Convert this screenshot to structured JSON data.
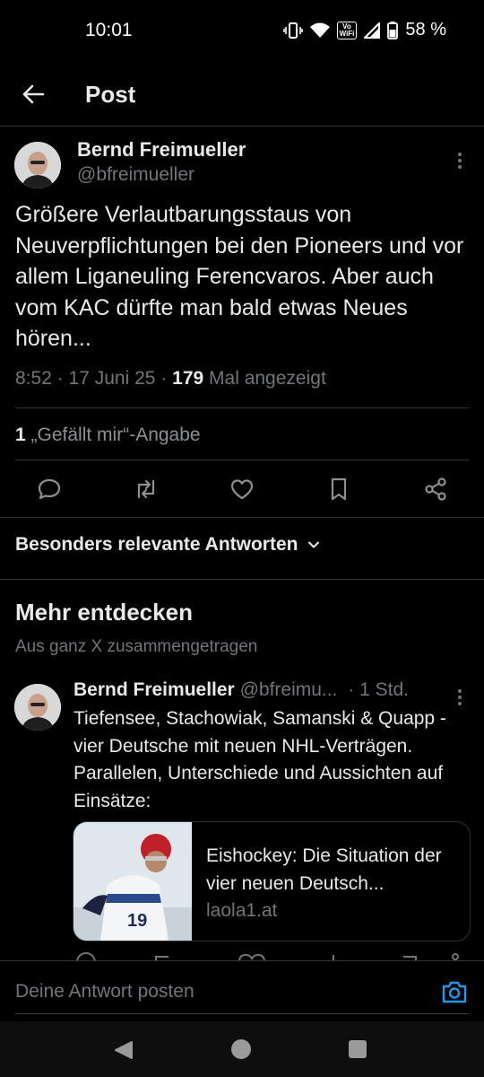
{
  "status_bar": {
    "time": "10:01",
    "vowifi": "Vo\nWiFi",
    "battery": "58 %"
  },
  "header": {
    "title": "Post"
  },
  "post": {
    "author_name": "Bernd Freimueller",
    "author_handle": "@bfreimueller",
    "text": "Größere Verlautbarungsstaus von Neuverpflichtungen bei den Pioneers und vor allem Liganeuling Ferencvaros. Aber auch vom KAC dürfte man bald etwas Neues hören...",
    "time": "8:52",
    "date": "17 Juni 25",
    "views_count": "179",
    "views_label": "Mal angezeigt",
    "likes_count": "1",
    "likes_label": "„Gefällt mir“-Angabe"
  },
  "sort": {
    "label": "Besonders relevante Antworten"
  },
  "discover": {
    "title": "Mehr entdecken",
    "subtitle": "Aus ganz X zusammengetragen"
  },
  "rec_post": {
    "author_name": "Bernd Freimueller",
    "author_handle": "@bfreimu...",
    "time": "· 1 Std.",
    "text": "Tiefensee, Stachowiak, Samanski & Quapp - vier Deutsche mit neuen NHL-Verträgen. Parallelen, Unterschiede und Aussichten auf Einsätze:",
    "card": {
      "title": "Eishockey: Die Situation der vier neuen Deutsch...",
      "domain": "laola1.at"
    }
  },
  "reply": {
    "placeholder": "Deine Antwort posten"
  },
  "colors": {
    "background": "#000000",
    "text": "#e7e9ea",
    "muted": "#71767b",
    "divider": "#2f3336",
    "accent": "#1d9bf0"
  },
  "icons": [
    "back-arrow-icon",
    "more-icon",
    "reply-icon",
    "repost-icon",
    "like-icon",
    "bookmark-icon",
    "share-icon",
    "chevron-down-icon",
    "camera-icon",
    "nav-back-icon",
    "nav-home-icon",
    "nav-recents-icon"
  ]
}
